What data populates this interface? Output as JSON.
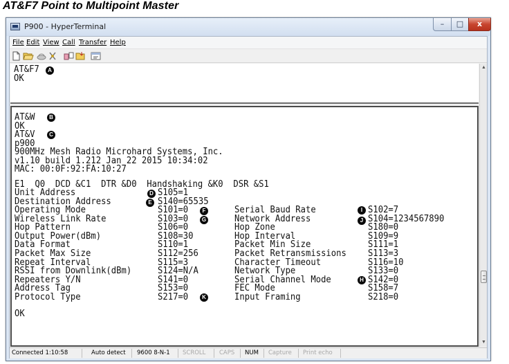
{
  "doc_title": "AT&F7 Point to Multipoint Master",
  "window": {
    "title": "P900 - HyperTerminal",
    "controls": {
      "minimize": "–",
      "maximize": "□",
      "close": "x"
    }
  },
  "menu": [
    "File",
    "Edit",
    "View",
    "Call",
    "Transfer",
    "Help"
  ],
  "toolbar_icons": [
    "new-icon",
    "open-icon",
    "disconnect-icon",
    "connect-icon",
    "send-icon",
    "receive-icon",
    "properties-icon"
  ],
  "terminal_top": {
    "line1": "AT&F7",
    "line2": "OK"
  },
  "terminal_main": {
    "header_lines": [
      "AT&W",
      "OK",
      "AT&V",
      "p900",
      "900MHz Mesh Radio Microhard Systems, Inc.",
      "v1.10 build 1.212 Jan 22 2015 10:34:02",
      "MAC: 00:0F:92:FA:10:27"
    ],
    "config_line": "E1  Q0  DCD &C1  DTR &D0  Handshaking &K0  DSR &S1",
    "pre_lines": [
      {
        "label": "Unit Address",
        "value": "S105=1"
      },
      {
        "label": "Destination Address",
        "value": "S140=65535"
      }
    ],
    "table": [
      {
        "l_label": "Operating Mode",
        "l_value": "S101=0",
        "r_label": "Serial Baud Rate",
        "r_value": "S102=7"
      },
      {
        "l_label": "Wireless Link Rate",
        "l_value": "S103=0",
        "r_label": "Network Address",
        "r_value": "S104=1234567890"
      },
      {
        "l_label": "Hop Pattern",
        "l_value": "S106=0",
        "r_label": "Hop Zone",
        "r_value": "S180=0"
      },
      {
        "l_label": "Output Power(dBm)",
        "l_value": "S108=30",
        "r_label": "Hop Interval",
        "r_value": "S109=9"
      },
      {
        "l_label": "Data Format",
        "l_value": "S110=1",
        "r_label": "Packet Min Size",
        "r_value": "S111=1"
      },
      {
        "l_label": "Packet Max Size",
        "l_value": "S112=256",
        "r_label": "Packet Retransmissions",
        "r_value": "S113=3"
      },
      {
        "l_label": "Repeat Interval",
        "l_value": "S115=3",
        "r_label": "Character Timeout",
        "r_value": "S116=10"
      },
      {
        "l_label": "RSSI from Downlink(dBm)",
        "l_value": "S124=N/A",
        "r_label": "Network Type",
        "r_value": "S133=0"
      },
      {
        "l_label": "Repeaters Y/N",
        "l_value": "S141=0",
        "r_label": "Serial Channel Mode",
        "r_value": "S142=0"
      },
      {
        "l_label": "Address Tag",
        "l_value": "S153=0",
        "r_label": "FEC Mode",
        "r_value": "S158=7"
      },
      {
        "l_label": "Protocol Type",
        "l_value": "S217=0",
        "r_label": "Input Framing",
        "r_value": "S218=0"
      }
    ],
    "final_line": "OK"
  },
  "callouts": {
    "a": "A",
    "b": "B",
    "c": "C",
    "d": "D",
    "e": "E",
    "f": "F",
    "g": "G",
    "h": "H",
    "i": "I",
    "j": "J",
    "k": "K"
  },
  "status": {
    "connected": "Connected 1:10:58",
    "detect": "Auto detect",
    "port": "9600 8-N-1",
    "scroll": "SCROLL",
    "caps": "CAPS",
    "num": "NUM",
    "capture": "Capture",
    "print_echo": "Print echo"
  }
}
